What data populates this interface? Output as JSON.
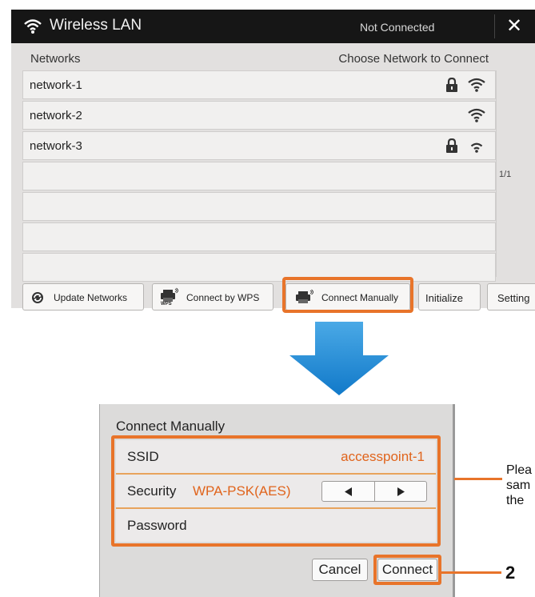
{
  "window": {
    "title": "Wireless LAN",
    "status": "Not Connected",
    "close_glyph": "✕"
  },
  "networks_header": "Networks",
  "choose_header": "Choose Network to Connect",
  "networks": [
    {
      "name": "network-1",
      "locked": true
    },
    {
      "name": "network-2",
      "locked": false
    },
    {
      "name": "network-3",
      "locked": true
    },
    {
      "name": "",
      "locked": false
    },
    {
      "name": "",
      "locked": false
    },
    {
      "name": "",
      "locked": false
    },
    {
      "name": "",
      "locked": false
    }
  ],
  "page_indicator": "1/1",
  "buttons": {
    "update": "Update Networks",
    "wps": "Connect by WPS",
    "wps_icon_caption": "WPS",
    "manual": "Connect Manually",
    "initialize": "Initialize",
    "setting": "Setting"
  },
  "dialog": {
    "title": "Connect Manually",
    "ssid_label": "SSID",
    "ssid_value": "accesspoint-1",
    "security_label": "Security",
    "security_value": "WPA-PSK(AES)",
    "password_label": "Password",
    "cancel": "Cancel",
    "connect": "Connect"
  },
  "callout_text": "Plea\nsam\nthe",
  "step_number": "2",
  "colors": {
    "accent": "#e8742a",
    "value_text": "#e0641c",
    "arrow": "#1f8fd8",
    "titlebar": "#161616"
  },
  "icons": [
    "wifi-icon",
    "close-icon",
    "lock-icon",
    "signal-icon",
    "refresh-icon",
    "printer-icon",
    "left-arrow-icon",
    "right-arrow-icon",
    "down-arrow-icon"
  ]
}
